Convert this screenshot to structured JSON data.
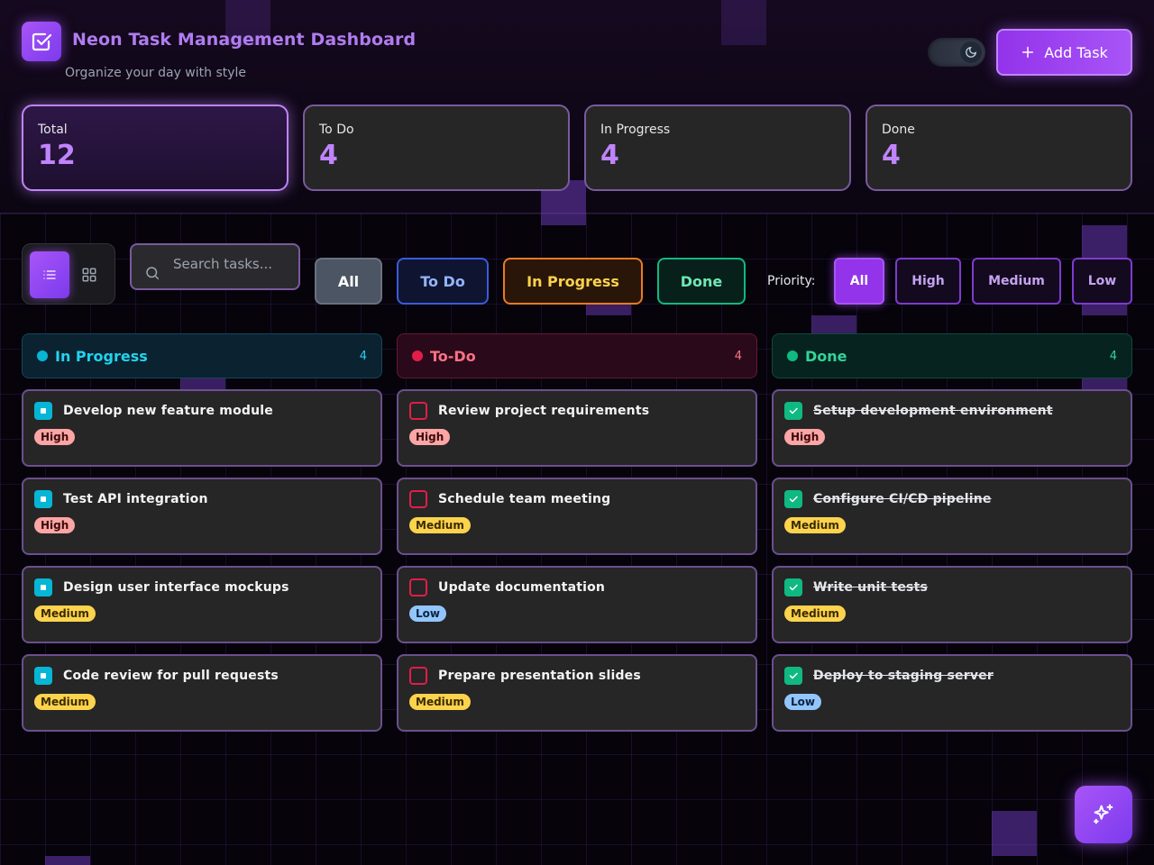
{
  "header": {
    "title": "Neon Task Management Dashboard",
    "subtitle": "Organize your day with style",
    "add_task_label": "Add Task"
  },
  "stats": [
    {
      "label": "Total",
      "value": "12"
    },
    {
      "label": "To Do",
      "value": "4"
    },
    {
      "label": "In Progress",
      "value": "4"
    },
    {
      "label": "Done",
      "value": "4"
    }
  ],
  "toolbar": {
    "search_placeholder": "Search tasks...",
    "status_filters": [
      "All",
      "To Do",
      "In Progress",
      "Done"
    ],
    "priority_label": "Priority:",
    "priority_filters": [
      "All",
      "High",
      "Medium",
      "Low"
    ]
  },
  "columns": [
    {
      "name": "In Progress",
      "count": "4",
      "status": "prog",
      "cards": [
        {
          "title": "Develop new feature module",
          "priority": "High"
        },
        {
          "title": "Test API integration",
          "priority": "High"
        },
        {
          "title": "Design user interface mockups",
          "priority": "Medium"
        },
        {
          "title": "Code review for pull requests",
          "priority": "Medium"
        }
      ]
    },
    {
      "name": "To-Do",
      "count": "4",
      "status": "todo",
      "cards": [
        {
          "title": "Review project requirements",
          "priority": "High"
        },
        {
          "title": "Schedule team meeting",
          "priority": "Medium"
        },
        {
          "title": "Update documentation",
          "priority": "Low"
        },
        {
          "title": "Prepare presentation slides",
          "priority": "Medium"
        }
      ]
    },
    {
      "name": "Done",
      "count": "4",
      "status": "done",
      "cards": [
        {
          "title": "Setup development environment",
          "priority": "High"
        },
        {
          "title": "Configure CI/CD pipeline",
          "priority": "Medium"
        },
        {
          "title": "Write unit tests",
          "priority": "Medium"
        },
        {
          "title": "Deploy to staging server",
          "priority": "Low"
        }
      ]
    }
  ],
  "colors": {
    "accent": "#a855f7",
    "in_progress": "#06b6d4",
    "todo": "#e11d48",
    "done": "#10b981"
  }
}
